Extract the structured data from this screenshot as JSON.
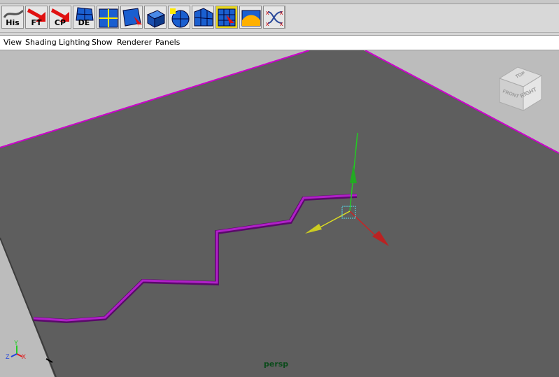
{
  "shelf": {
    "tools": [
      {
        "label": "His",
        "icon": "history-icon"
      },
      {
        "label": "FT",
        "icon": "freeze-transform-icon"
      },
      {
        "label": "CP",
        "icon": "center-pivot-icon"
      },
      {
        "label": "DE",
        "icon": "delete-edges-icon"
      },
      {
        "label": "",
        "icon": "split-polygon-icon"
      },
      {
        "label": "",
        "icon": "select-face-icon"
      },
      {
        "label": "",
        "icon": "extrude-icon"
      },
      {
        "label": "",
        "icon": "smooth-sphere-icon"
      },
      {
        "label": "",
        "icon": "bridge-icon"
      },
      {
        "label": "",
        "icon": "select-vertex-icon"
      },
      {
        "label": "",
        "icon": "wedge-icon"
      },
      {
        "label": "",
        "icon": "node-graph-icon"
      }
    ]
  },
  "menubar": {
    "items": [
      "View",
      "Shading",
      "Lighting",
      "Show",
      "Renderer",
      "Panels"
    ]
  },
  "viewport": {
    "camera": "persp",
    "viewcube_faces": {
      "top": "TOP",
      "front": "FRONT",
      "right": "RIGHT"
    },
    "axis_labels": {
      "x": "X",
      "y": "Y",
      "z": "Z"
    },
    "colors": {
      "background": "#5e5e5e",
      "ground": "#bcbcbc",
      "edge_highlight": "#cc00cc",
      "curve": "#7a0a8a",
      "manip_x": "#cc2222",
      "manip_y": "#22bb22",
      "manip_z": "#cccc22",
      "camera_label": "#0a4a1a"
    }
  }
}
